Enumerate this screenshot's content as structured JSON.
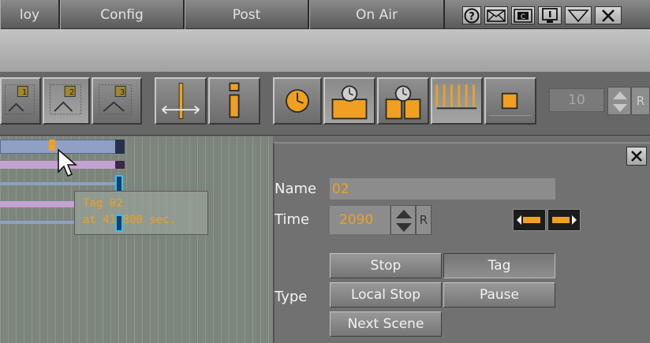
{
  "menubar": {
    "tabs": [
      {
        "label": "loy"
      },
      {
        "label": "Config"
      },
      {
        "label": "Post"
      },
      {
        "label": "On Air"
      }
    ],
    "system_icons": [
      "help-icon",
      "mail-icon",
      "cc-icon",
      "info-icon",
      "minimize-icon",
      "close-icon"
    ]
  },
  "toolbar": {
    "buttons": [
      {
        "icon": "layout-1-icon",
        "label": "1"
      },
      {
        "icon": "layout-2-icon",
        "label": "2"
      },
      {
        "icon": "layout-3-icon",
        "label": "3"
      },
      {
        "icon": "time-scale-icon"
      },
      {
        "icon": "info-icon"
      },
      {
        "icon": "clock-icon"
      },
      {
        "icon": "clock-block-icon"
      },
      {
        "icon": "clock-split-icon"
      },
      {
        "icon": "grid-lines-icon"
      },
      {
        "icon": "stop-square-icon"
      }
    ],
    "counter": {
      "value": "10",
      "reset_label": "R"
    }
  },
  "tooltip": {
    "line1": "Tag 02",
    "line2": "at 41.800 sec."
  },
  "panel": {
    "name_label": "Name",
    "name_value": "02",
    "time_label": "Time",
    "time_value": "2090",
    "reset_label": "R",
    "type_label": "Type",
    "type_options": [
      "Stop",
      "Tag",
      "Local Stop",
      "Pause",
      "Next Scene"
    ],
    "selected_type": "Tag"
  },
  "colors": {
    "accent": "#f0a020",
    "menubar": "#6e6e6e",
    "panel": "#717171",
    "track_blue": "#8fa0c4",
    "track_purple": "#c3a2d2"
  }
}
